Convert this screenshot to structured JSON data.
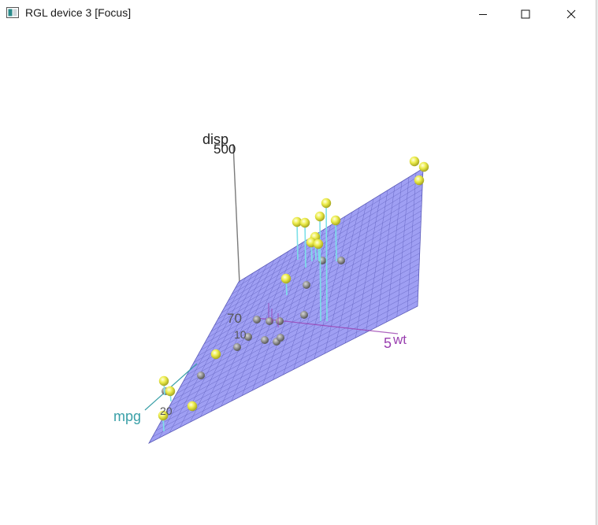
{
  "window": {
    "title": "RGL device 3 [Focus]",
    "controls": {
      "minimize": "minimize-icon",
      "maximize": "maximize-icon",
      "close": "close-icon"
    }
  },
  "colors": {
    "plane": "#8a8af0",
    "plane_grid": "#5a5ab8",
    "points": "#ecec4a",
    "drop_lines": "#7de0e8",
    "mpg_axis": "#3aa0a8",
    "wt_axis": "#9a40b0",
    "disp_axis": "#333333",
    "shadow_points": "#8a8a8a"
  },
  "chart_data": {
    "type": "scatter",
    "subtype": "3d-scatter-with-regression-plane",
    "axes": {
      "x": {
        "label": "wt",
        "ticks": [
          "5"
        ]
      },
      "y": {
        "label": "mpg",
        "ticks": [
          "10",
          "20"
        ]
      },
      "z": {
        "label": "disp",
        "ticks": [
          "500"
        ]
      },
      "extra_tick": "70"
    },
    "surface": {
      "kind": "plane",
      "fitted": true,
      "grid": true
    },
    "points": [
      {
        "wt": 5.4,
        "mpg": 10.4,
        "disp": 472
      },
      {
        "wt": 5.3,
        "mpg": 10.4,
        "disp": 460
      },
      {
        "wt": 5.3,
        "mpg": 14.7,
        "disp": 440
      },
      {
        "wt": 3.6,
        "mpg": 14.3,
        "disp": 360
      },
      {
        "wt": 3.4,
        "mpg": 18.7,
        "disp": 360
      },
      {
        "wt": 3.8,
        "mpg": 15.5,
        "disp": 318
      },
      {
        "wt": 3.4,
        "mpg": 15.2,
        "disp": 304
      },
      {
        "wt": 3.8,
        "mpg": 13.3,
        "disp": 350
      },
      {
        "wt": 3.8,
        "mpg": 19.2,
        "disp": 400
      },
      {
        "wt": 4.1,
        "mpg": 16.4,
        "disp": 276
      },
      {
        "wt": 3.7,
        "mpg": 17.3,
        "disp": 276
      },
      {
        "wt": 3.8,
        "mpg": 15.2,
        "disp": 276
      },
      {
        "wt": 3.4,
        "mpg": 15.8,
        "disp": 351
      },
      {
        "wt": 3.2,
        "mpg": 21.4,
        "disp": 258
      },
      {
        "wt": 3.4,
        "mpg": 18.1,
        "disp": 225
      },
      {
        "wt": 3.4,
        "mpg": 19.2,
        "disp": 168
      },
      {
        "wt": 3.2,
        "mpg": 17.8,
        "disp": 168
      },
      {
        "wt": 3.6,
        "mpg": 14.3,
        "disp": 145
      },
      {
        "wt": 2.6,
        "mpg": 21.0,
        "disp": 160
      },
      {
        "wt": 2.9,
        "mpg": 21.0,
        "disp": 160
      },
      {
        "wt": 2.3,
        "mpg": 22.8,
        "disp": 108
      },
      {
        "wt": 3.2,
        "mpg": 24.4,
        "disp": 147
      },
      {
        "wt": 3.1,
        "mpg": 22.8,
        "disp": 141
      },
      {
        "wt": 2.5,
        "mpg": 21.5,
        "disp": 120
      },
      {
        "wt": 2.1,
        "mpg": 26.0,
        "disp": 120
      },
      {
        "wt": 1.5,
        "mpg": 30.4,
        "disp": 95
      },
      {
        "wt": 1.6,
        "mpg": 30.4,
        "disp": 76
      },
      {
        "wt": 1.8,
        "mpg": 27.3,
        "disp": 79
      },
      {
        "wt": 2.2,
        "mpg": 32.4,
        "disp": 79
      },
      {
        "wt": 1.9,
        "mpg": 33.9,
        "disp": 71
      },
      {
        "wt": 2.8,
        "mpg": 15.0,
        "disp": 301
      },
      {
        "wt": 3.6,
        "mpg": 13.3,
        "disp": 350
      }
    ],
    "grid": false,
    "legend": "none"
  }
}
